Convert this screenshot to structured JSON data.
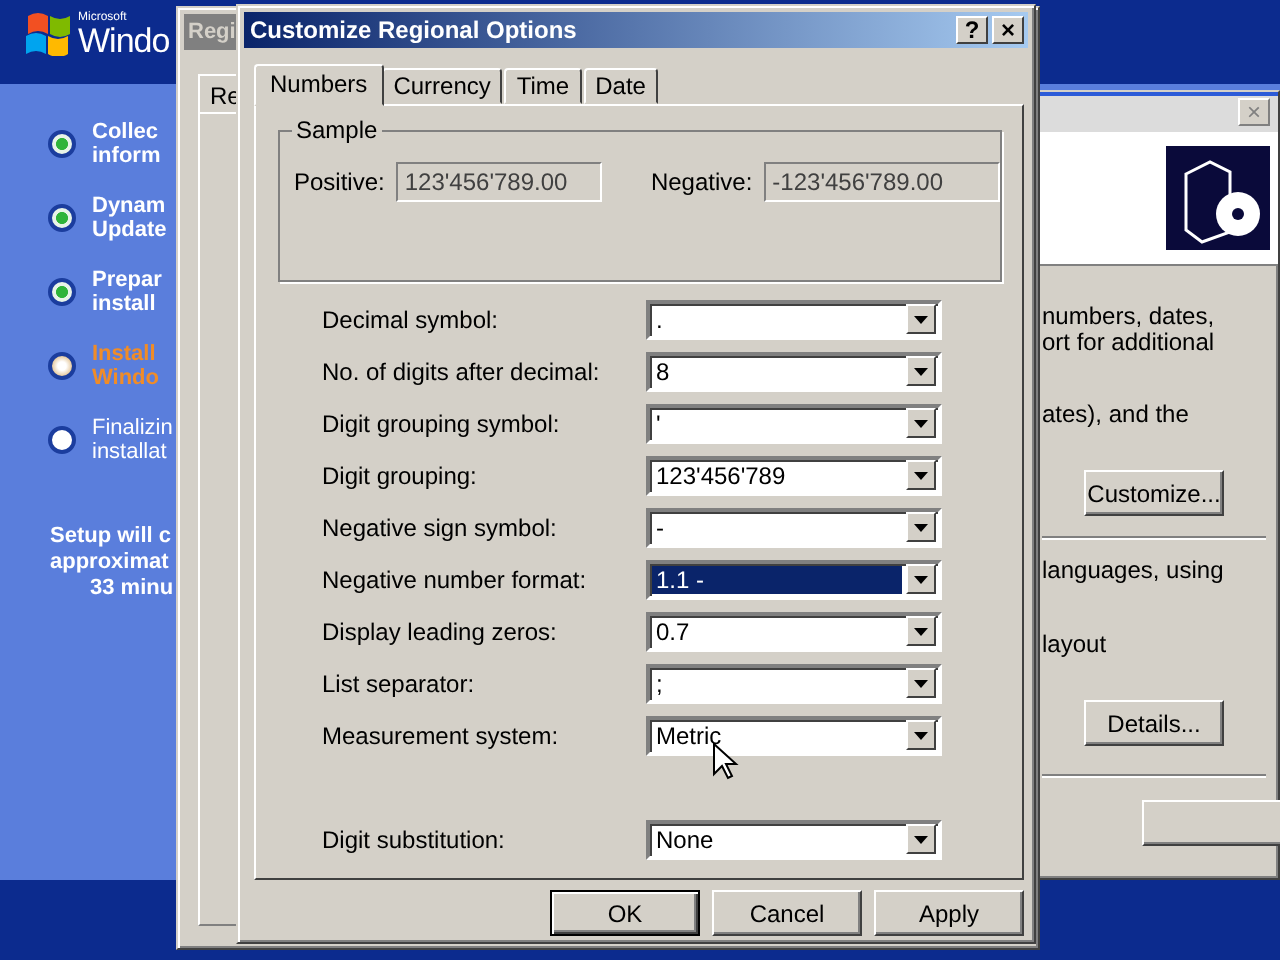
{
  "setup": {
    "brand": "Microsoft",
    "logo_text": "Windo",
    "steps": [
      {
        "lines": [
          "Collec",
          "inform"
        ],
        "kind": "done"
      },
      {
        "lines": [
          "Dynam",
          "Update"
        ],
        "kind": "done"
      },
      {
        "lines": [
          "Prepar",
          "install"
        ],
        "kind": "done"
      },
      {
        "lines": [
          "Install",
          "Windo"
        ],
        "kind": "current"
      },
      {
        "lines": [
          "Finalizin",
          "installat"
        ],
        "kind": "pending"
      }
    ],
    "estimate": [
      "Setup will c",
      "approximat",
      "33 minu"
    ]
  },
  "right_window": {
    "close": "×",
    "texts": [
      "numbers, dates,",
      "ort for additional",
      "ates), and the",
      "languages, using",
      "layout"
    ],
    "buttons": [
      "Customize...",
      "Details..."
    ]
  },
  "back_window": {
    "title": "Regi",
    "tab": "Re"
  },
  "dialog": {
    "title": "Customize Regional Options",
    "help": "?",
    "close": "×",
    "tabs": [
      {
        "label": "Numbers",
        "selected": true
      },
      {
        "label": "Currency",
        "selected": false
      },
      {
        "label": "Time",
        "selected": false
      },
      {
        "label": "Date",
        "selected": false
      }
    ],
    "sample": {
      "title": "Sample",
      "positive_label": "Positive:",
      "positive": "123'456'789.00",
      "negative_label": "Negative:",
      "negative": "-123'456'789.00"
    },
    "settings": [
      {
        "label": "Decimal symbol:",
        "value": ".",
        "focused": false
      },
      {
        "label": "No. of digits after decimal:",
        "value": "8",
        "focused": false
      },
      {
        "label": "Digit grouping symbol:",
        "value": "'",
        "focused": false
      },
      {
        "label": "Digit grouping:",
        "value": "123'456'789",
        "focused": false
      },
      {
        "label": "Negative sign symbol:",
        "value": "-",
        "focused": false
      },
      {
        "label": "Negative number format:",
        "value": "1.1 -",
        "focused": true
      },
      {
        "label": "Display leading zeros:",
        "value": "0.7",
        "focused": false
      },
      {
        "label": "List separator:",
        "value": ";",
        "focused": false
      },
      {
        "label": "Measurement system:",
        "value": "Metric",
        "focused": false
      }
    ],
    "digit_substitution": {
      "label": "Digit substitution:",
      "value": "None",
      "focused": false
    },
    "buttons": [
      "OK",
      "Cancel",
      "Apply"
    ]
  }
}
